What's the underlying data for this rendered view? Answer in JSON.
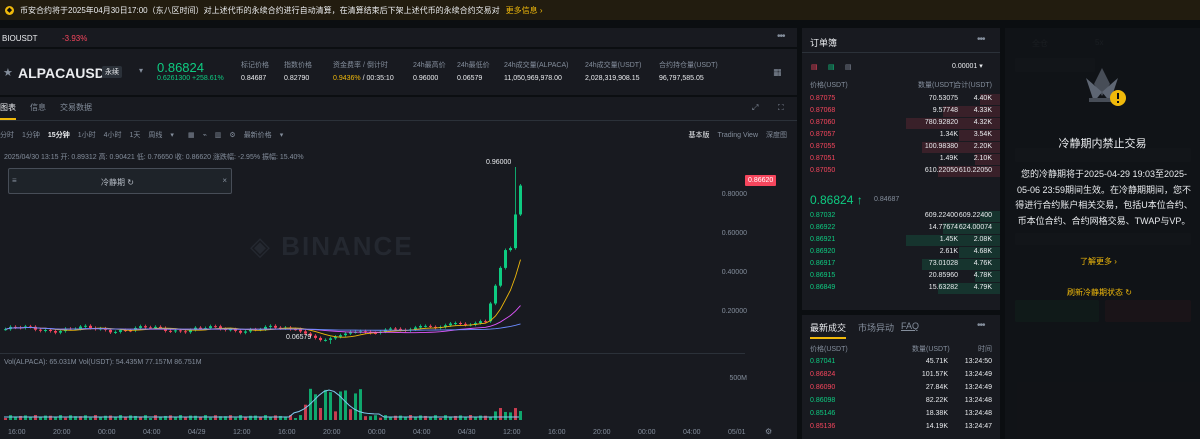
{
  "banner": {
    "text": "币安合约将于2025年04月30日17:00（东八区时间）对上述代币的永续合约进行自动清算，在清算结束后下架上述代币的永续合约交易对",
    "more": "更多信息 ›"
  },
  "strip": {
    "symbol": "BIOUSDT",
    "change": "-3.93%"
  },
  "header": {
    "symbol": "ALPACAUSDT",
    "tag": "永续",
    "price": "0.86824",
    "sub_change": "0.6261300",
    "sub_pct": "+258.61%",
    "stats": [
      {
        "label": "标记价格",
        "value": "0.84687"
      },
      {
        "label": "指数价格",
        "value": "0.82790"
      },
      {
        "label": "资金费率 / 倒计时",
        "value": "0.9436%",
        "value2": " / 00:35:10"
      },
      {
        "label": "24h最高价",
        "value": "0.96000"
      },
      {
        "label": "24h最低价",
        "value": "0.06579"
      },
      {
        "label": "24h成交量(ALPACA)",
        "value": "11,050,969,978.00"
      },
      {
        "label": "24h成交量(USDT)",
        "value": "2,028,319,908.15"
      },
      {
        "label": "合约持仓量(USDT)",
        "value": "96,797,585.05"
      }
    ]
  },
  "chart": {
    "tabs": [
      "图表",
      "信息",
      "交易数据"
    ],
    "intervals": [
      "分时",
      "1分钟",
      "15分钟",
      "1小时",
      "4小时",
      "1天",
      "周线"
    ],
    "latest": "最新价格",
    "views": [
      "基本版",
      "Trading View",
      "深度图"
    ],
    "ohlc": "2025/04/30 13:15  开: 0.89312  高: 0.90421  低: 0.76650  收: 0.86620  涨跌幅: -2.95%  振幅: 15.40%",
    "cooldown_label": "冷静期 ↻",
    "watermark": "BINANCE",
    "price_tag": "0.86620",
    "high_label": "0.96000",
    "low_label": "0.06579",
    "y_labels": [
      "0.80000",
      "0.60000",
      "0.40000",
      "0.20000"
    ],
    "vol_legend": "Vol(ALPACA):  65.031M   Vol(USDT):  54.435M  77.157M  86.751M",
    "vol_label": "500M",
    "x_labels": [
      "16:00",
      "20:00",
      "00:00",
      "04:00",
      "04/29",
      "12:00",
      "16:00",
      "20:00",
      "00:00",
      "04:00",
      "04/30",
      "12:00",
      "16:00",
      "20:00",
      "00:00",
      "04:00",
      "05/01"
    ]
  },
  "chart_data": {
    "type": "candlestick",
    "title": "ALPACAUSDT 15分钟",
    "high": 0.96,
    "low": 0.06579,
    "close": 0.8662,
    "ylim": [
      0.05,
      0.96
    ]
  },
  "book": {
    "title": "订单簿",
    "precision": "0.00001 ▾",
    "cols": [
      "价格(USDT)",
      "数量(USDT)",
      "合计(USDT)"
    ],
    "asks": [
      [
        "0.87075",
        "70.53075",
        "4.40K"
      ],
      [
        "0.87068",
        "9.57748",
        "4.33K"
      ],
      [
        "0.87060",
        "780.92820",
        "4.32K"
      ],
      [
        "0.87057",
        "1.34K",
        "3.54K"
      ],
      [
        "0.87055",
        "100.98380",
        "2.20K"
      ],
      [
        "0.87051",
        "1.49K",
        "2.10K"
      ],
      [
        "0.87050",
        "610.22050",
        "610.22050"
      ]
    ],
    "mid": "0.86824 ↑",
    "mark": "0.84687",
    "bids": [
      [
        "0.87032",
        "609.22400",
        "609.22400"
      ],
      [
        "0.86922",
        "14.77674",
        "624.00074"
      ],
      [
        "0.86921",
        "1.45K",
        "2.08K"
      ],
      [
        "0.86920",
        "2.61K",
        "4.68K"
      ],
      [
        "0.86917",
        "73.01028",
        "4.76K"
      ],
      [
        "0.86915",
        "20.85960",
        "4.78K"
      ],
      [
        "0.86849",
        "15.63282",
        "4.79K"
      ]
    ]
  },
  "trades": {
    "tabs": [
      "最新成交",
      "市场异动",
      "FAQ"
    ],
    "cols": [
      "价格(USDT)",
      "数量(USDT)",
      "时间"
    ],
    "rows": [
      [
        "0.87041",
        "45.71K",
        "13:24:50",
        "g"
      ],
      [
        "0.86824",
        "101.57K",
        "13:24:49",
        "r"
      ],
      [
        "0.86090",
        "27.84K",
        "13:24:49",
        "r"
      ],
      [
        "0.86098",
        "82.22K",
        "13:24:48",
        "g"
      ],
      [
        "0.85146",
        "18.38K",
        "13:24:48",
        "g"
      ],
      [
        "0.85136",
        "14.19K",
        "13:24:47",
        "r"
      ]
    ]
  },
  "modal": {
    "title": "冷静期内禁止交易",
    "body": "您的冷静期将于2025-04-29 19:03至2025-05-06 23:59期间生效。在冷静期期间，您不得进行合约账户相关交易，包括U本位合约、币本位合约、合约网格交易、TWAP与VP。",
    "learn": "了解更多 ›",
    "refresh": "刷新冷静期状态 ↻"
  }
}
